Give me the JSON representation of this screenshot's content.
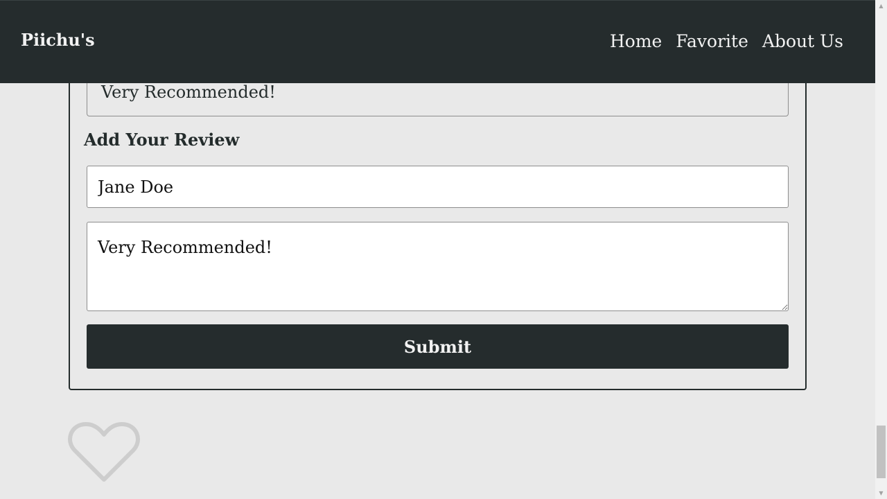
{
  "navbar": {
    "brand": "Piichu's",
    "links": [
      "Home",
      "Favorite",
      "About Us"
    ]
  },
  "previous_review": {
    "text": "Very Recommended!"
  },
  "review_form": {
    "title": "Add Your Review",
    "name_value": "Jane Doe",
    "review_value": "Very Recommended!",
    "submit_label": "Submit"
  },
  "favorite": {
    "icon": "heart-outline-icon",
    "color": "#cdcdcd"
  },
  "colors": {
    "navbar_bg": "#252c2d",
    "page_bg": "#e9e9e9",
    "text": "#242c2c"
  }
}
